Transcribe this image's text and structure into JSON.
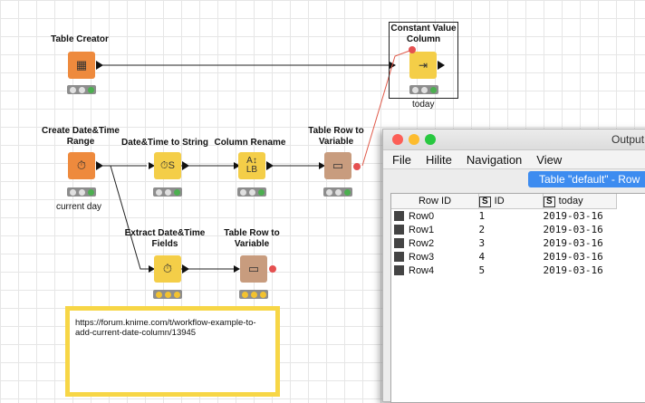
{
  "nodes": {
    "table_creator": {
      "label": "Table Creator"
    },
    "constant_value_column": {
      "label": "Constant Value Column",
      "sublabel": "today"
    },
    "create_datetime_range": {
      "label": "Create Date&Time Range",
      "sublabel": "current day"
    },
    "datetime_to_string": {
      "label": "Date&Time to String"
    },
    "column_rename": {
      "label": "Column Rename"
    },
    "table_row_to_variable_1": {
      "label": "Table Row to Variable"
    },
    "extract_datetime_fields": {
      "label": "Extract Date&Time Fields"
    },
    "table_row_to_variable_2": {
      "label": "Table Row to Variable"
    }
  },
  "annotation": {
    "text": "https://forum.knime.com/t/workflow-example-to-add-current-date-column/13945"
  },
  "output_window": {
    "title": "Output",
    "menu": [
      "File",
      "Hilite",
      "Navigation",
      "View"
    ],
    "tab_label": "Table \"default\" - Row",
    "columns": [
      {
        "label": "Row ID",
        "type_badge": ""
      },
      {
        "label": "ID",
        "type_badge": "S"
      },
      {
        "label": "today",
        "type_badge": "S"
      }
    ],
    "rows": [
      {
        "row_id": "Row0",
        "id": "1",
        "today": "2019-03-16"
      },
      {
        "row_id": "Row1",
        "id": "2",
        "today": "2019-03-16"
      },
      {
        "row_id": "Row2",
        "id": "3",
        "today": "2019-03-16"
      },
      {
        "row_id": "Row3",
        "id": "4",
        "today": "2019-03-16"
      },
      {
        "row_id": "Row4",
        "id": "5",
        "today": "2019-03-16"
      }
    ]
  },
  "colors": {
    "node_orange": "#ee8a3d",
    "node_yellow": "#f4ce48",
    "node_brown": "#c89c7e",
    "variable_port": "#e55050",
    "annotation_border": "#f7d646",
    "tab_blue": "#3d8cf0"
  }
}
